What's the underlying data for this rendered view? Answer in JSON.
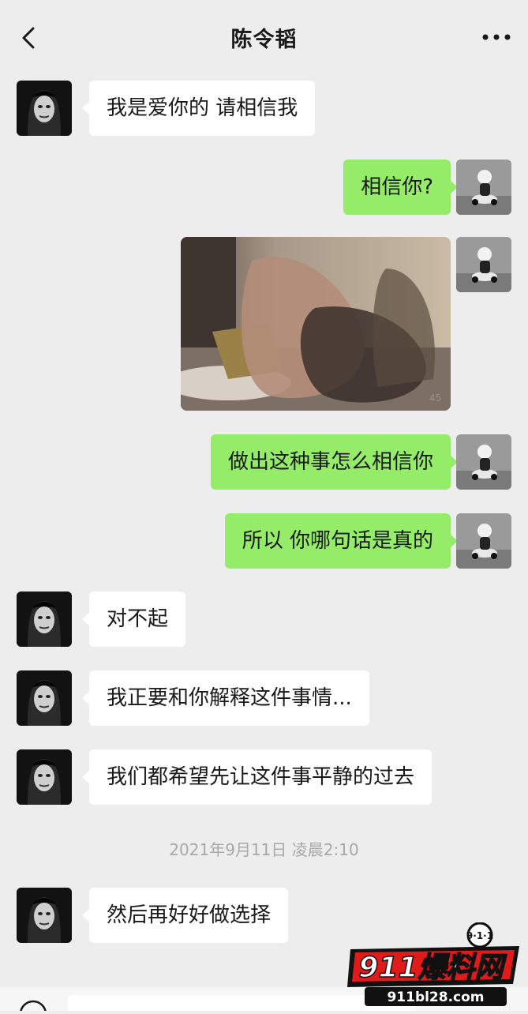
{
  "header": {
    "title": "陈令韬",
    "back_icon": "chevron-left-icon",
    "more_icon": "more-dots-icon"
  },
  "messages": [
    {
      "side": "left",
      "text": "我是爱你的 请相信我"
    },
    {
      "side": "right",
      "text": "相信你?"
    },
    {
      "side": "right",
      "type": "image",
      "image_desc": "censored photo",
      "image_corner_text": "45"
    },
    {
      "side": "right",
      "text": "做出这种事怎么相信你"
    },
    {
      "side": "right",
      "text": "所以 你哪句话是真的"
    },
    {
      "side": "left",
      "text": "对不起"
    },
    {
      "side": "left",
      "text": "我正要和你解释这件事情..."
    },
    {
      "side": "left",
      "text": "我们都希望先让这件事平静的过去"
    },
    {
      "side": "left",
      "text": "然后再好好做选择"
    }
  ],
  "timestamp": "2021年9月11日 凌晨2:10",
  "watermark": {
    "badge": "9·1·1",
    "brand": "911爆料网",
    "url": "911bl28.com"
  },
  "colors": {
    "background": "#ededed",
    "bubble_self": "#95ec69",
    "bubble_other": "#ffffff",
    "timestamp": "#a8a8a8"
  }
}
